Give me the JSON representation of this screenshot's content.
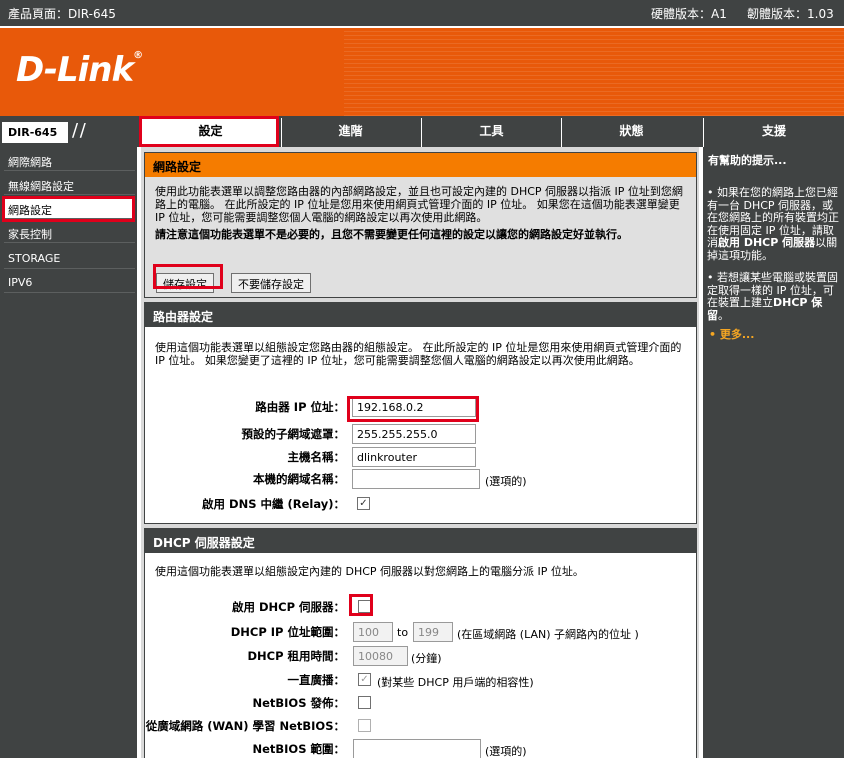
{
  "topbar": {
    "product": "產品頁面：DIR-645",
    "hardware": "硬體版本：A1",
    "firmware": "韌體版本：1.03"
  },
  "brand": {
    "logo": "D-Link",
    "reg": "®"
  },
  "model": "DIR-645",
  "tabs": [
    {
      "label": "設定"
    },
    {
      "label": "進階"
    },
    {
      "label": "工具"
    },
    {
      "label": "狀態"
    },
    {
      "label": "支援"
    }
  ],
  "sidebar": {
    "items": [
      {
        "label": "網際網路"
      },
      {
        "label": "無線網路設定"
      },
      {
        "label": "網路設定"
      },
      {
        "label": "家長控制"
      },
      {
        "label": "STORAGE"
      },
      {
        "label": "IPV6"
      }
    ]
  },
  "network_settings": {
    "title": "網路設定",
    "description": "使用此功能表選單以調整您路由器的內部網路設定，並且也可設定內建的 DHCP 伺服器以指派 IP 位址到您網路上的電腦。 在此所設定的 IP 位址是您用來使用網頁式管理介面的 IP 位址。 如果您在這個功能表選單變更 IP 位址，您可能需要調整您個人電腦的網路設定以再次使用此網路。",
    "warning": "請注意這個功能表選單不是必要的，且您不需要變更任何這裡的設定以讓您的網路設定好並執行。",
    "save_label": "儲存設定",
    "dont_save_label": "不要儲存設定"
  },
  "router_settings": {
    "title": "路由器設定",
    "description": "使用這個功能表選單以組態設定您路由器的組態設定。 在此所設定的 IP 位址是您用來使用網頁式管理介面的 IP 位址。 如果您變更了這裡的 IP 位址，您可能需要調整您個人電腦的網路設定以再次使用此網路。",
    "ip_label": "路由器 IP 位址：",
    "ip_value": "192.168.0.2",
    "mask_label": "預設的子網域遮罩：",
    "mask_value": "255.255.255.0",
    "host_label": "主機名稱：",
    "host_value": "dlinkrouter",
    "domain_label": "本機的網域名稱：",
    "domain_value": "",
    "optional": "(選項的)",
    "dns_relay_label": "啟用 DNS 中繼 (Relay)：",
    "dns_relay_checked": true
  },
  "dhcp": {
    "title": "DHCP 伺服器設定",
    "description": "使用這個功能表選單以組態設定內建的 DHCP 伺服器以對您網路上的電腦分派 IP 位址。",
    "enable_label": "啟用 DHCP 伺服器：",
    "enable_checked": false,
    "range_label": "DHCP IP 位址範圍：",
    "range_start": "100",
    "range_to": "to",
    "range_end": "199",
    "range_note": "(在區域網路 (LAN) 子網路內的位址 )",
    "lease_label": "DHCP 租用時間：",
    "lease_value": "10080",
    "lease_unit": "(分鐘)",
    "broadcast_label": "一直廣播：",
    "broadcast_checked": true,
    "broadcast_note": "(對某些 DHCP 用戶端的相容性)",
    "netbios_announce_label": "NetBIOS 發佈：",
    "netbios_wan_label": "從廣域網路 (WAN) 學習 NetBIOS：",
    "netbios_scope_label": "NetBIOS 範圍：",
    "netbios_scope_value": "",
    "optional": "(選項的)"
  },
  "help": {
    "title": "有幫助的提示...",
    "tip1_a": "如果在您的網路上您已經有一台 DHCP 伺服器，或在您網路上的所有裝置均正在使用固定 IP 位址，請取消",
    "tip1_b": "啟用 DHCP 伺服器",
    "tip1_c": "以關掉這項功能。",
    "tip2_a": "若想讓某些電腦或裝置固定取得一樣的 IP 位址，可在裝置上建立",
    "tip2_b": "DHCP 保留",
    "tip2_c": "。",
    "more": "更多..."
  },
  "colors": {
    "brand_orange": "#e8590a",
    "nav_dark": "#404343",
    "highlight_red": "#e0001b"
  }
}
